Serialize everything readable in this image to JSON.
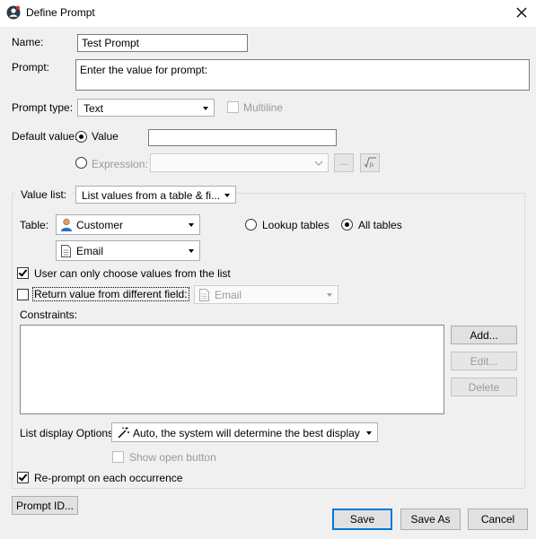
{
  "window": {
    "title": "Define Prompt",
    "close_icon": "close-icon"
  },
  "name": {
    "label": "Name:",
    "value": "Test Prompt"
  },
  "prompt": {
    "label": "Prompt:",
    "value": "Enter the value for prompt:"
  },
  "prompt_type": {
    "label": "Prompt type:",
    "value": "Text",
    "multiline_label": "Multiline",
    "multiline_checked": false
  },
  "default_value": {
    "label": "Default value:",
    "value_label": "Value",
    "value_text": "",
    "expression_label": "Expression:",
    "expression_text": "",
    "ellipsis_label": "...",
    "fx_label": "fx"
  },
  "value_list": {
    "label": "Value list:",
    "selected": "List values from a table & fi..."
  },
  "table": {
    "label": "Table:",
    "table_value": "Customer",
    "field_value": "Email",
    "lookup_label": "Lookup tables",
    "all_label": "All tables",
    "selected_option": "All tables"
  },
  "options": {
    "only_list_label": "User can only choose values from the list",
    "only_list_checked": true,
    "return_diff_label": "Return value from different field:",
    "return_diff_checked": false,
    "return_field_value": "Email"
  },
  "constraints": {
    "label": "Constraints:",
    "add": "Add...",
    "edit": "Edit...",
    "delete": "Delete"
  },
  "display": {
    "label": "List display Options:",
    "value": "Auto, the system will determine the best display",
    "show_open_label": "Show open button",
    "show_open_checked": false
  },
  "reprompt": {
    "label": "Re-prompt on each occurrence",
    "checked": true
  },
  "footer": {
    "prompt_id": "Prompt ID...",
    "save": "Save",
    "save_as": "Save As",
    "cancel": "Cancel"
  },
  "colors": {
    "accent": "#0078d7",
    "background": "#f0f0f0"
  }
}
